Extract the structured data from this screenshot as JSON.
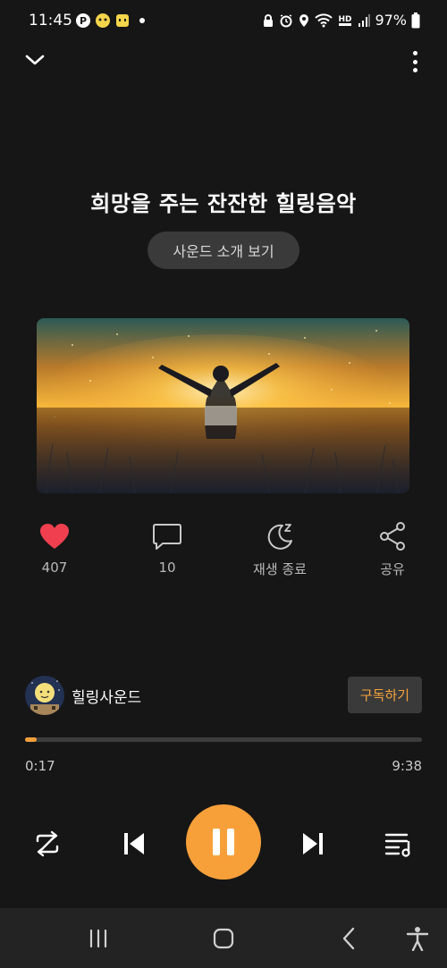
{
  "status_bar": {
    "time": "11:45",
    "battery": "97%",
    "left_icons": [
      "parking-app-icon",
      "emoji-face-icon",
      "emoji-square-icon",
      "dot-icon"
    ],
    "right_icons": [
      "lock-icon",
      "alarm-icon",
      "location-icon",
      "wifi-icon",
      "hd-voice-icon",
      "signal-icon",
      "battery-icon"
    ]
  },
  "player": {
    "title": "희망을 주는 잔잔한 힐링음악",
    "intro_button": "사운드 소개 보기"
  },
  "actions": {
    "like_count": "407",
    "comment_count": "10",
    "sleep_label": "재생 종료",
    "share_label": "공유"
  },
  "channel": {
    "name": "힐링사운드",
    "subscribe_label": "구독하기"
  },
  "progress": {
    "elapsed": "0:17",
    "total": "9:38",
    "fraction": 0.03
  },
  "colors": {
    "accent": "#f7a03a",
    "like": "#f0404f",
    "background": "#161616"
  }
}
